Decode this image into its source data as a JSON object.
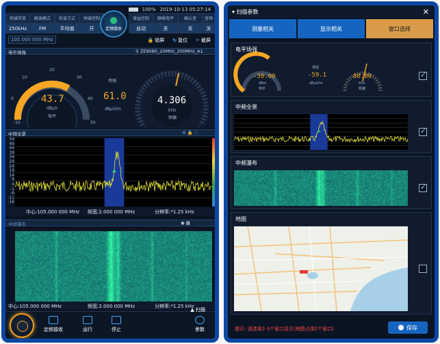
{
  "status": {
    "battery": "100%",
    "datetime": "2019-10-13 05:27:14",
    "battery_level": 1.0
  },
  "params": [
    {
      "header": "频谱带宽",
      "value": "250kHz"
    },
    {
      "header": "解调模式",
      "value": "FM"
    },
    {
      "header": "检波方式",
      "value": "平均值"
    },
    {
      "header": "频谱控制",
      "value": "开"
    },
    {
      "header": "增益控制",
      "value": "自动"
    },
    {
      "header": "静噪电平",
      "value": "关"
    },
    {
      "header": "确认音",
      "value": "关"
    },
    {
      "header": "音频",
      "value": "关"
    }
  ],
  "center_button": "定频接收",
  "freq_input": "105.000 000 MHz",
  "tools": {
    "lock": "锁屏",
    "reset": "复位",
    "screenshot": "截屏"
  },
  "level": {
    "section": "电平场强",
    "antenna": "ZE9080_20MHz_200MHz_A1",
    "level_value": "43.7",
    "level_unit": "dBμV",
    "level_label": "电平",
    "field_label": "场强",
    "field_value": "61.0",
    "field_unit": "dBμV/m",
    "offset_value": "4.306",
    "offset_unit": "kHz",
    "offset_label": "频偏",
    "ticks": [
      "-10",
      "0",
      "10",
      "20",
      "30",
      "40",
      "50"
    ]
  },
  "spectrum": {
    "section": "中频全景",
    "yticks": [
      "54",
      "49",
      "44",
      "39",
      "34",
      "29",
      "24",
      "19",
      "14",
      "9",
      "4",
      "-1",
      "-6",
      "-11",
      "-16"
    ],
    "center": "中心:105.000 000 MHz",
    "span": "频宽:2.000 000 MHz",
    "res": "分辨率:*1.25 kHz"
  },
  "waterfall": {
    "section": "中频瀑布",
    "center": "中心:105.000 000 MHz",
    "span": "频宽:2.000 000 MHz",
    "res": "分辨率:*1.25 kHz"
  },
  "bottom": {
    "scan": "扫描",
    "fixed": "定频接收",
    "run": "运行",
    "stop": "停止",
    "params": "参数"
  },
  "right": {
    "title": "扫描参数",
    "tabs": [
      "测量相关",
      "显示相关",
      "窗口选择"
    ],
    "sections": [
      {
        "label": "电平场强",
        "checked": true
      },
      {
        "label": "中频全景",
        "checked": true
      },
      {
        "label": "中频瀑布",
        "checked": true
      },
      {
        "label": "地图",
        "checked": false
      }
    ],
    "mini": {
      "level": "-30.00",
      "level_unit": "dBm",
      "level_label": "电平",
      "field_label": "场强",
      "field": "-59.1",
      "field_unit": "dBμV/m",
      "offset": "80.00",
      "offset_unit": "kHz",
      "offset_label": "频偏"
    },
    "hint": "提示: 请选择2-3个窗口显示(地图占用2个窗口)",
    "save": "保存"
  }
}
